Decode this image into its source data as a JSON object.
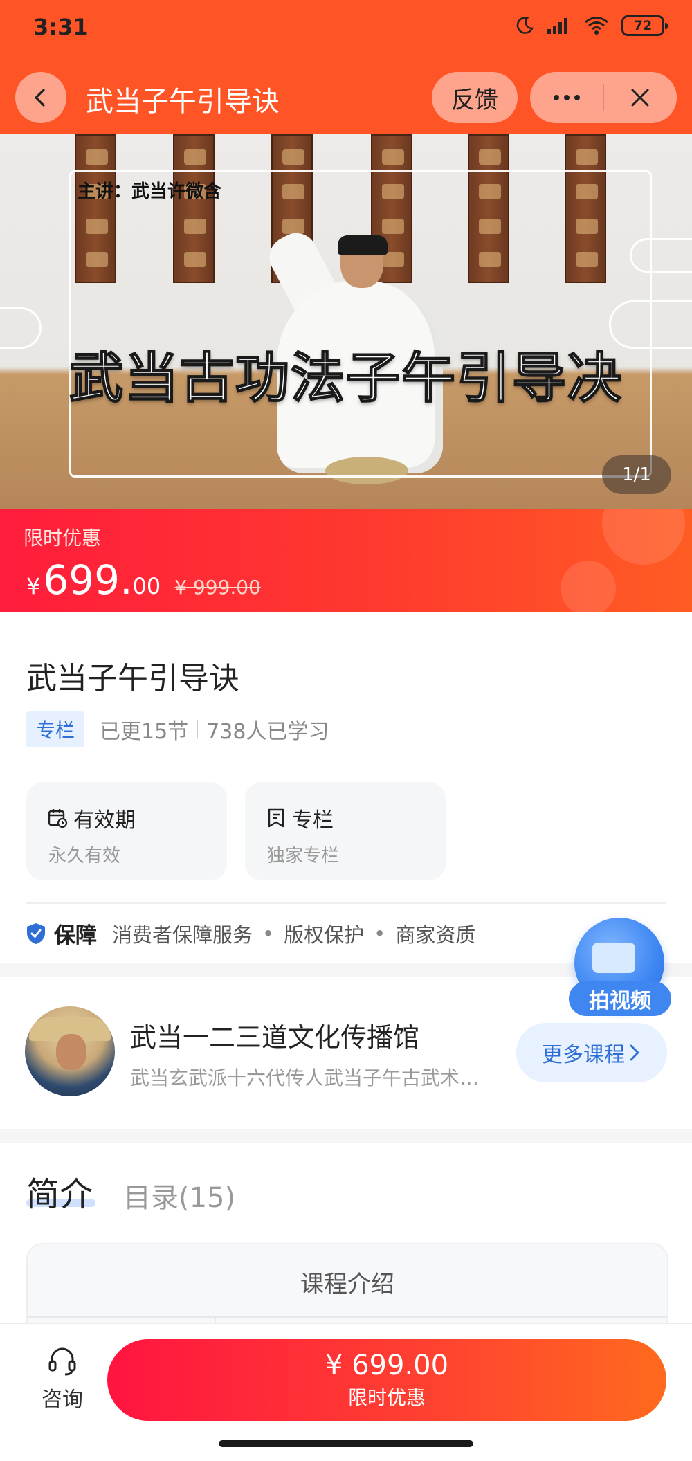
{
  "status": {
    "time": "3:31",
    "battery": "72"
  },
  "nav": {
    "title": "武当子午引导诀",
    "feedback": "反馈"
  },
  "hero": {
    "teacher": "主讲：武当许微含",
    "title": "武当古功法子午引导决",
    "counter": "1/1"
  },
  "promo": {
    "label": "限时优惠",
    "currency": "¥",
    "price_int": "699.",
    "price_dec": "00",
    "original_price": "¥ 999.00"
  },
  "course": {
    "title": "武当子午引导诀",
    "tag": "专栏",
    "updated": "已更15节",
    "learners": "738人已学习",
    "cards": [
      {
        "icon": "calendar-clock-icon",
        "title": "有效期",
        "sub": "永久有效"
      },
      {
        "icon": "bookmark-doc-icon",
        "title": "专栏",
        "sub": "独家专栏"
      }
    ],
    "guarantee": {
      "label": "保障",
      "items": [
        "消费者保障服务",
        "版权保护",
        "商家资质"
      ]
    }
  },
  "shop": {
    "name": "武当一二三道文化传播馆",
    "description": "武当玄武派十六代传人武当子午古武术…",
    "more_label": "更多课程"
  },
  "float_video": {
    "label": "拍视频"
  },
  "tabs": [
    {
      "label": "简介",
      "active": true
    },
    {
      "label": "目录(15)",
      "active": false
    }
  ],
  "intro_card": {
    "title": "课程介绍"
  },
  "bottom": {
    "consult": "咨询",
    "buy_price": "¥ 699.00",
    "buy_sub": "限时优惠"
  },
  "colors": {
    "brand": "#ff5526",
    "promo_red": "#ff1c3c",
    "link_blue": "#2e6ed6"
  }
}
